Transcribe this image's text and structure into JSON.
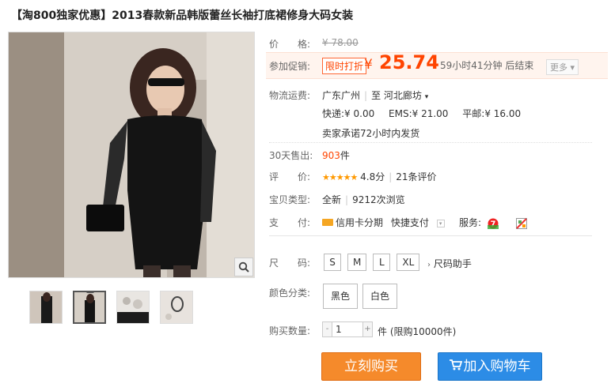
{
  "title": "【淘800独家优惠】2013春款新品韩版蕾丝长袖打底裙修身大码女装",
  "price": {
    "label": "价　　格:",
    "original": "¥ 78.00",
    "promo_label": "参加促销:",
    "promo_tag": "限时打折",
    "currency": "¥",
    "current": "25.74",
    "countdown": "59小时41分钟 后结束",
    "more": "更多"
  },
  "shipping": {
    "label": "物流运费:",
    "from": "广东广州",
    "to_label": "至",
    "to": "河北廊坊",
    "express": "快递:¥ 0.00",
    "ems": "EMS:¥ 21.00",
    "mail": "平邮:¥ 16.00",
    "promise": "卖家承诺72小时内发货"
  },
  "sales": {
    "label": "30天售出:",
    "count": "903",
    "unit": "件"
  },
  "rating": {
    "label": "评　　价:",
    "stars": "★★★★★",
    "score": "4.8分",
    "reviews": "21条评价"
  },
  "item_type": {
    "label": "宝贝类型:",
    "condition": "全新",
    "views": "9212次浏览"
  },
  "payment": {
    "label": "支　　付:",
    "credit": "信用卡分期",
    "quick": "快捷支付",
    "service_label": "服务:"
  },
  "size": {
    "label": "尺　　码:",
    "options": [
      "S",
      "M",
      "L",
      "XL"
    ],
    "help": "尺码助手"
  },
  "color": {
    "label": "颜色分类:",
    "options": [
      "黑色",
      "白色"
    ]
  },
  "quantity": {
    "label": "购买数量:",
    "value": "1",
    "limit": "件 (限购10000件)"
  },
  "buttons": {
    "buy": "立刻购买",
    "cart": "加入购物车"
  },
  "colors": {
    "accent": "#ff4400",
    "buy": "#f58a2b",
    "cart": "#2c8ce6",
    "stars": "#ff9900"
  }
}
